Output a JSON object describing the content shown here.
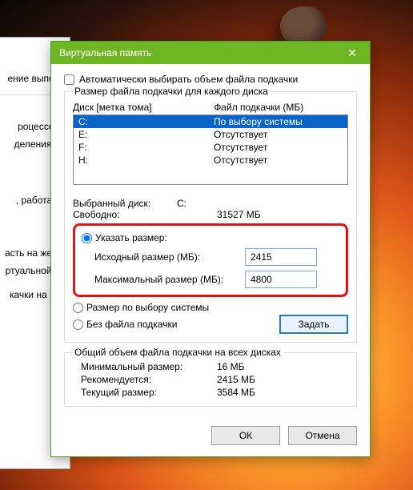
{
  "title": "Виртуальная память",
  "auto_label": "Автоматически выбирать объем файла подкачки",
  "auto_checked": false,
  "group_legend": "Размер файла подкачки для каждого диска",
  "col_disk": "Диск [метка тома]",
  "col_pf": "Файл подкачки (МБ)",
  "drives": [
    {
      "letter": "C:",
      "status": "По выбору системы",
      "selected": true
    },
    {
      "letter": "E:",
      "status": "Отсутствует",
      "selected": false
    },
    {
      "letter": "F:",
      "status": "Отсутствует",
      "selected": false
    },
    {
      "letter": "H:",
      "status": "Отсутствует",
      "selected": false
    }
  ],
  "selected_drive_label": "Выбранный диск:",
  "selected_drive": "C:",
  "free_label": "Свободно:",
  "free_value": "31527 МБ",
  "radio_custom": "Указать размер:",
  "initial_label": "Исходный размер (МБ):",
  "initial_value": "2415",
  "max_label": "Максимальный размер (МБ):",
  "max_value": "4800",
  "radio_system": "Размер по выбору системы",
  "radio_none": "Без файла подкачки",
  "set_button": "Задать",
  "summary_legend": "Общий объем файла подкачки на всех дисках",
  "min_label": "Минимальный размер:",
  "min_value": "16 МБ",
  "rec_label": "Рекомендуется:",
  "rec_value": "2415 МБ",
  "cur_label": "Текущий размер:",
  "cur_value": "3584 МБ",
  "ok_label": "ОК",
  "cancel_label": "Отмена",
  "left_fragments": {
    "a": "ение выполн",
    "b": "роцессора",
    "c": "деления ре",
    "d": ", работаюц",
    "e": "асть на жестк",
    "f": "ртуальной па",
    "g": "качки на все"
  }
}
